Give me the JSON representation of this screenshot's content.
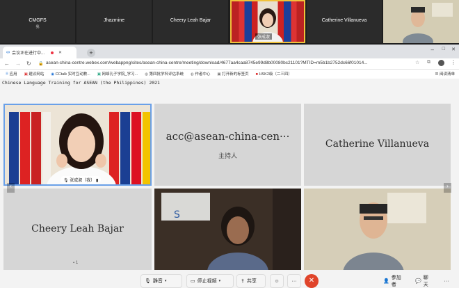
{
  "filmstrip": {
    "tiles": [
      {
        "name": "CMGFS",
        "sub": "我"
      },
      {
        "name": "Jhazmine"
      },
      {
        "name": "Cheery Leah Bajar"
      },
      {
        "name": "张成淑"
      },
      {
        "name": "Catherine Villanueva"
      },
      {
        "name": ""
      }
    ]
  },
  "browser": {
    "tab_title": "会议正在进行中...",
    "new_tab": "+",
    "url": "asean-china-centre.webex.com/webappng/sites/asean-china-centre/meeting/download/4677aa4caa8745e99d8b00080bc21101?MTID=m5b1b2752dc66f01014...",
    "bookmarks": [
      {
        "label": "应用",
        "icon": "apps-grid-icon"
      },
      {
        "label": "建议网站",
        "icon": "page-icon"
      },
      {
        "label": "CCtalk 实时互动教...",
        "icon": "cctalk-icon"
      },
      {
        "label": "网络孔子学院_学习...",
        "icon": "page-icon"
      },
      {
        "label": "第四批学科评估系统",
        "icon": "globe-icon"
      },
      {
        "label": "作者中心",
        "icon": "globe-icon"
      },
      {
        "label": "打开新的标签页",
        "icon": "page-icon"
      },
      {
        "label": "HSK2级（二三四）",
        "icon": "folder-icon"
      }
    ],
    "reading_list": "阅读清单"
  },
  "meeting": {
    "title": "Chinese Language Training for ASEAN (the Philippines) 2021",
    "participants": [
      {
        "name": "张成淑（我）",
        "type": "video-flags"
      },
      {
        "name": "acc@asean-china-cen···",
        "role": "主持人",
        "type": "name"
      },
      {
        "name": "Catherine Villanueva",
        "type": "name"
      },
      {
        "name": "Cheery Leah Bajar",
        "type": "name",
        "note": "1"
      },
      {
        "name": "",
        "type": "video-room"
      },
      {
        "name": "",
        "type": "video-man"
      }
    ],
    "toolbar": {
      "mute": "静音",
      "stop_video": "停止视频",
      "share": "共享",
      "more": "···",
      "participants": "参加者",
      "chat": "聊天"
    }
  }
}
